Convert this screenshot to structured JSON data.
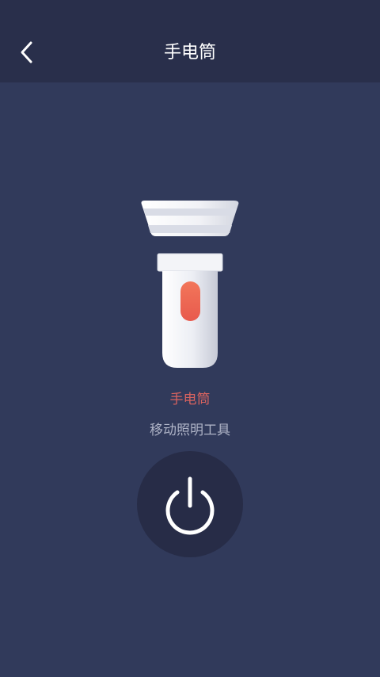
{
  "header": {
    "title": "手电筒",
    "back_icon": "chevron-left-icon"
  },
  "main": {
    "illustration": "flashlight-illustration",
    "app_name": "手电筒",
    "subtitle": "移动照明工具",
    "power_icon": "power-icon"
  },
  "colors": {
    "background": "#313a5b",
    "header_background": "#292f4b",
    "app_name_color": "#d8635f",
    "subtitle_color": "#aeb3c6",
    "power_button_bg": "#272c47",
    "accent_switch": "#f26b52"
  }
}
